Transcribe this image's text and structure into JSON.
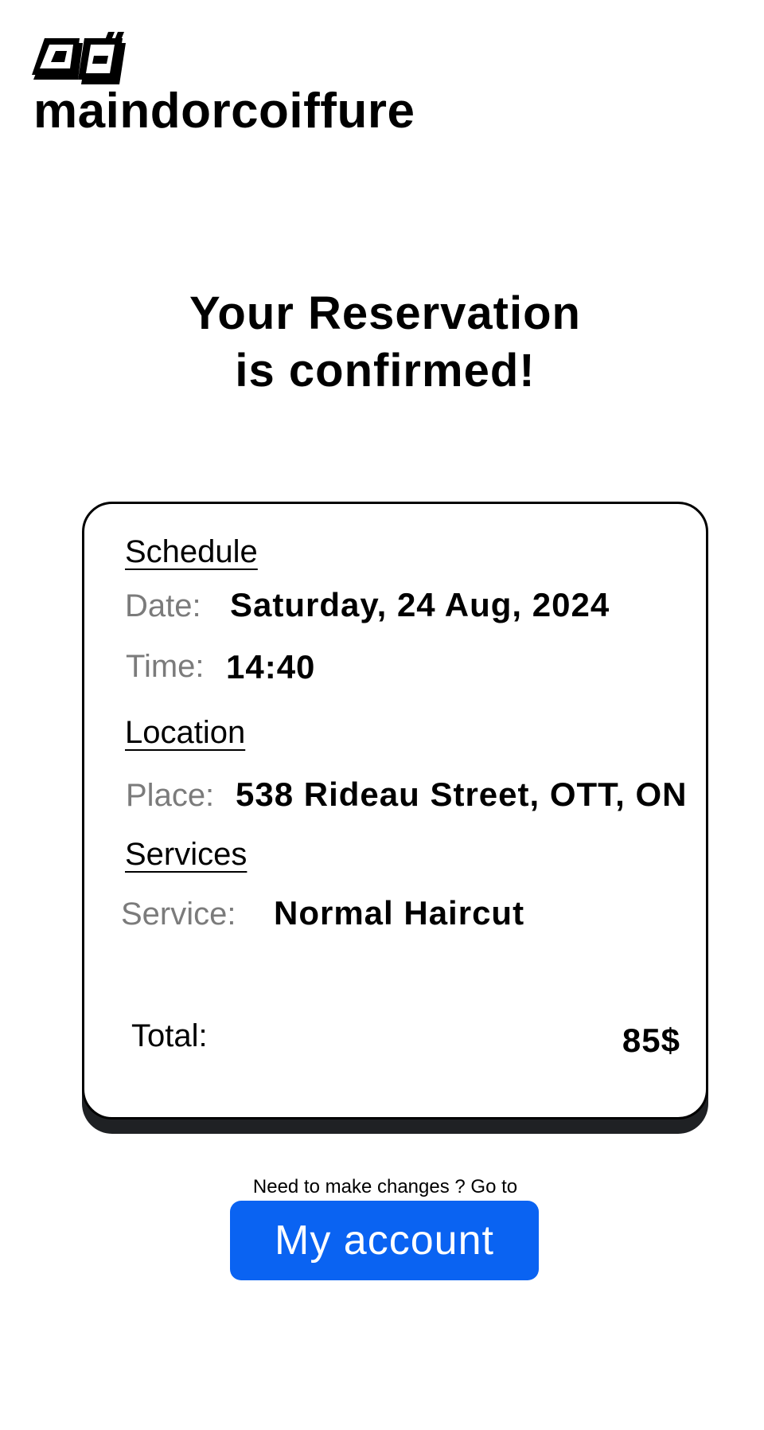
{
  "header": {
    "logo_icon": "brand-logo-icon",
    "brand_name": "maindorcoiffure"
  },
  "main": {
    "title_line1": "Your Reservation",
    "title_line2": "is confirmed!"
  },
  "reservation": {
    "schedule_heading": "Schedule",
    "date_label": "Date:",
    "date_value": "Saturday, 24 Aug, 2024",
    "time_label": "Time:",
    "time_value": "14:40",
    "location_heading": "Location",
    "place_label": "Place:",
    "place_value": "538 Rideau Street, OTT, ON",
    "services_heading": "Services",
    "service_label": "Service:",
    "service_value": "Normal Haircut",
    "total_label": "Total:",
    "total_value": "85$"
  },
  "footer": {
    "changes_note": "Need to make changes ? Go to",
    "account_button": "My account"
  },
  "colors": {
    "accent": "#0a63f2",
    "card_border": "#000000",
    "card_shadow": "#1f2124",
    "label_gray": "#7b7b7b"
  }
}
